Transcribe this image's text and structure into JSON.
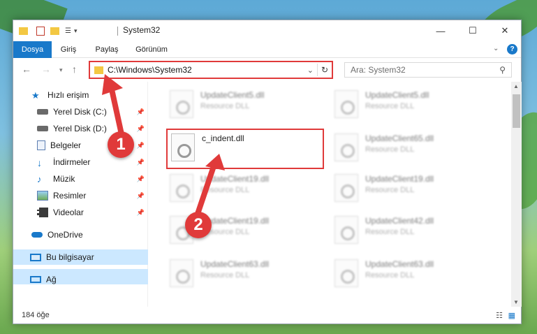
{
  "window": {
    "title": "System32",
    "minimize": "—",
    "maximize": "☐",
    "close": "✕"
  },
  "ribbon": {
    "tabs": [
      "Dosya",
      "Giriş",
      "Paylaş",
      "Görünüm"
    ]
  },
  "nav": {
    "address": "C:\\Windows\\System32",
    "search_placeholder": "Ara: System32"
  },
  "sidebar": {
    "items": [
      {
        "label": "Hızlı erişim",
        "icon": "star-icon"
      },
      {
        "label": "Yerel Disk (C:)",
        "icon": "drive-icon"
      },
      {
        "label": "Yerel Disk (D:)",
        "icon": "drive-icon"
      },
      {
        "label": "Belgeler",
        "icon": "documents-icon"
      },
      {
        "label": "İndirmeler",
        "icon": "download-icon"
      },
      {
        "label": "Müzik",
        "icon": "music-icon"
      },
      {
        "label": "Resimler",
        "icon": "pictures-icon"
      },
      {
        "label": "Videolar",
        "icon": "video-icon"
      },
      {
        "label": "OneDrive",
        "icon": "cloud-icon"
      },
      {
        "label": "Bu bilgisayar",
        "icon": "computer-icon"
      },
      {
        "label": "Ağ",
        "icon": "network-icon"
      }
    ]
  },
  "files": [
    {
      "name": "UpdateClient5.dll",
      "type": "Resource DLL"
    },
    {
      "name": "UpdateClient5.dll",
      "type": "Resource DLL"
    },
    {
      "name": "c_indent.dll",
      "type": ""
    },
    {
      "name": "UpdateClient65.dll",
      "type": "Resource DLL"
    },
    {
      "name": "UpdateClient19.dll",
      "type": "Resource DLL"
    },
    {
      "name": "UpdateClient19.dll",
      "type": "Resource DLL"
    },
    {
      "name": "UpdateClient19.dll",
      "type": "Resource DLL"
    },
    {
      "name": "UpdateClient42.dll",
      "type": "Resource DLL"
    },
    {
      "name": "UpdateClient63.dll",
      "type": "Resource DLL"
    },
    {
      "name": "UpdateClient63.dll",
      "type": "Resource DLL"
    }
  ],
  "status": {
    "count": "184 öğe"
  },
  "callouts": [
    "1",
    "2"
  ],
  "colors": {
    "accent": "#1979ca",
    "highlight": "#e03a3a",
    "selected": "#cce8ff"
  }
}
